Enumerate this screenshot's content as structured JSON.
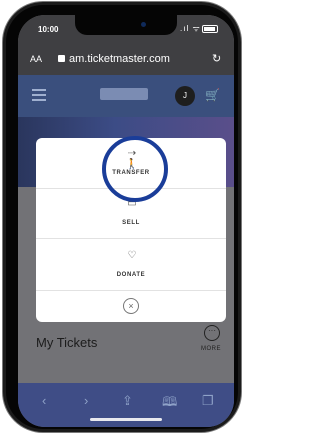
{
  "status_bar": {
    "time": "10:00",
    "signal_text": ".ıl ᯤ"
  },
  "browser": {
    "text_size_label": "AA",
    "url": "am.ticketmaster.com",
    "reload_glyph": "↻"
  },
  "site_header": {
    "avatar_initial": "J"
  },
  "modal": {
    "items": [
      {
        "label": "TRANSFER",
        "icon": "transfer-person-icon"
      },
      {
        "label": "SELL",
        "icon": "sell-hand-money-icon"
      },
      {
        "label": "DONATE",
        "icon": "donate-heart-hand-icon"
      }
    ],
    "close_glyph": "×"
  },
  "page": {
    "section_title": "My Tickets",
    "more_label": "MORE"
  },
  "toolbar": {
    "back": "‹",
    "forward": "›",
    "share": "⇪",
    "bookmarks": "🕮",
    "tabs": "❐"
  },
  "colors": {
    "highlight_ring": "#1a3d99",
    "site_header": "#3a4f7d",
    "toolbar": "#3f4d86"
  }
}
